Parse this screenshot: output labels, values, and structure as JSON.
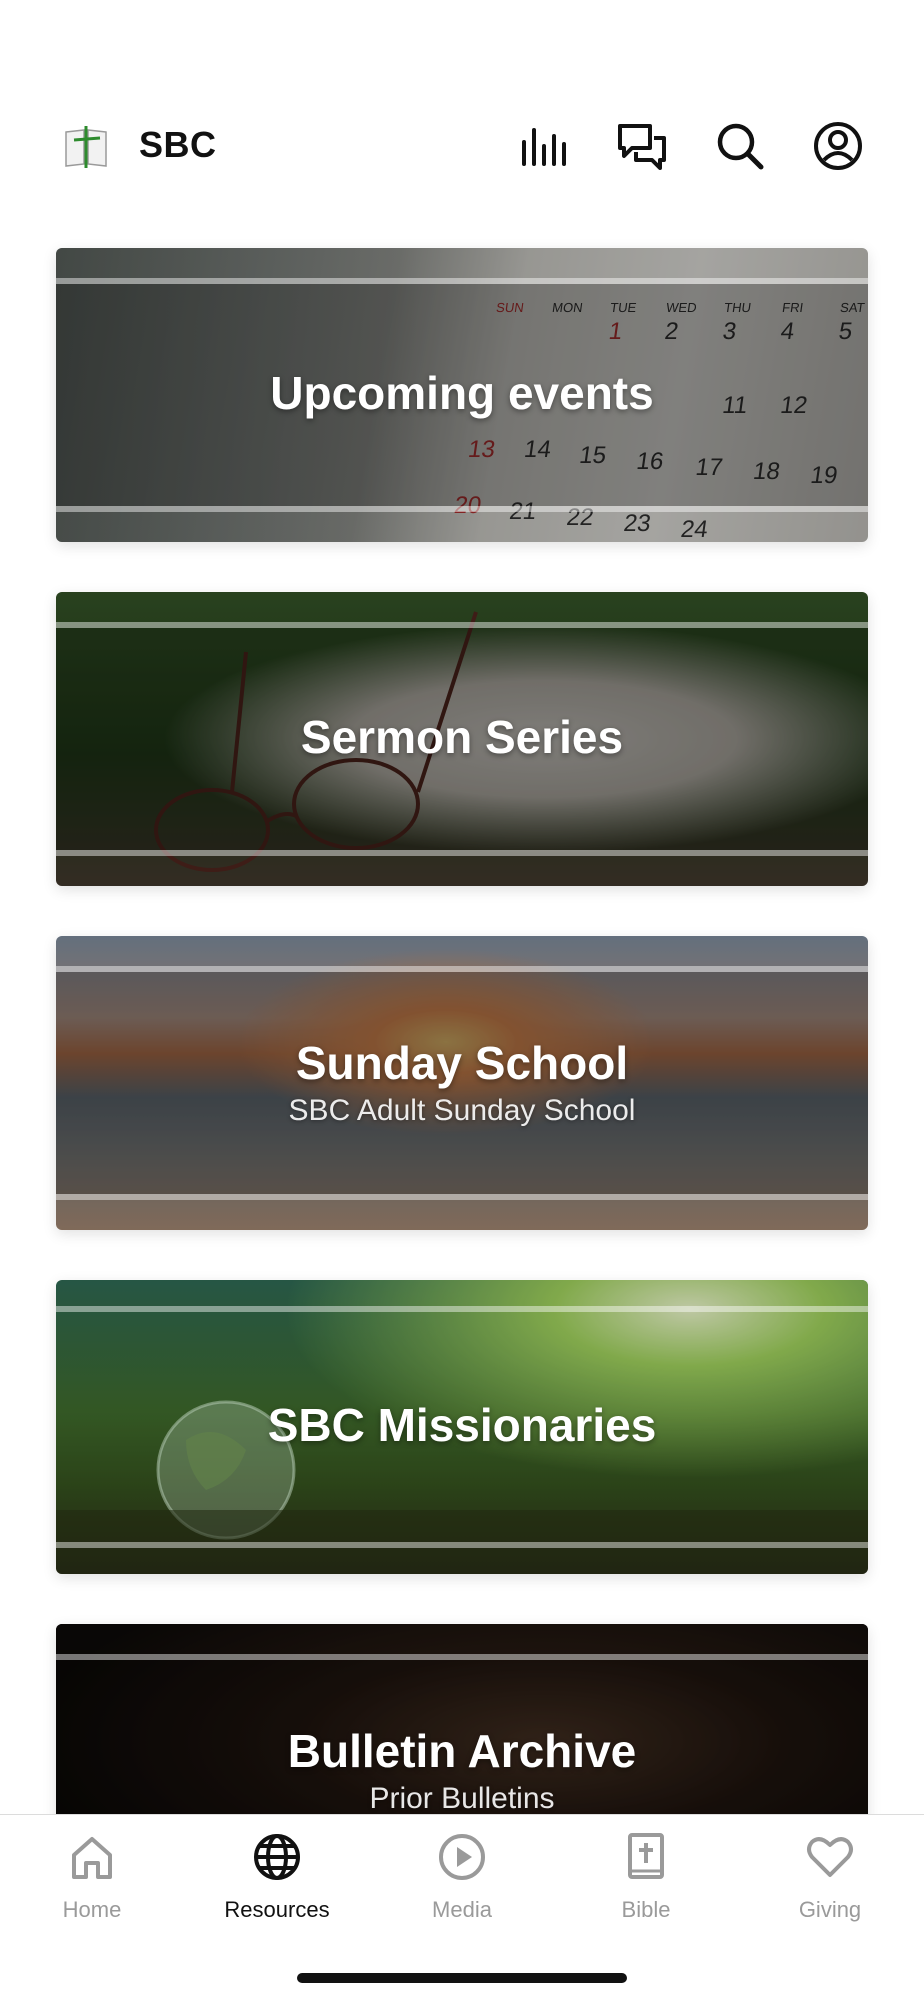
{
  "header": {
    "app_title": "SBC",
    "logo_icon": "open-bible-cross-icon",
    "actions": [
      {
        "icon": "audio-bars-icon"
      },
      {
        "icon": "chat-bubbles-icon"
      },
      {
        "icon": "search-icon"
      },
      {
        "icon": "account-icon"
      }
    ]
  },
  "cards": [
    {
      "title": "Upcoming events",
      "subtitle": ""
    },
    {
      "title": "Sermon Series",
      "subtitle": ""
    },
    {
      "title": "Sunday School",
      "subtitle": "SBC Adult Sunday School"
    },
    {
      "title": "SBC Missionaries",
      "subtitle": ""
    },
    {
      "title": "Bulletin Archive",
      "subtitle": "Prior Bulletins"
    }
  ],
  "tabbar": {
    "items": [
      {
        "label": "Home",
        "icon": "home-icon",
        "active": false
      },
      {
        "label": "Resources",
        "icon": "globe-icon",
        "active": true
      },
      {
        "label": "Media",
        "icon": "play-circle-icon",
        "active": false
      },
      {
        "label": "Bible",
        "icon": "bible-icon",
        "active": false
      },
      {
        "label": "Giving",
        "icon": "heart-icon",
        "active": false
      }
    ]
  },
  "colors": {
    "active_tab": "#111111",
    "inactive_tab": "#9a9a9a",
    "logo_cross": "#2e8b2e"
  }
}
